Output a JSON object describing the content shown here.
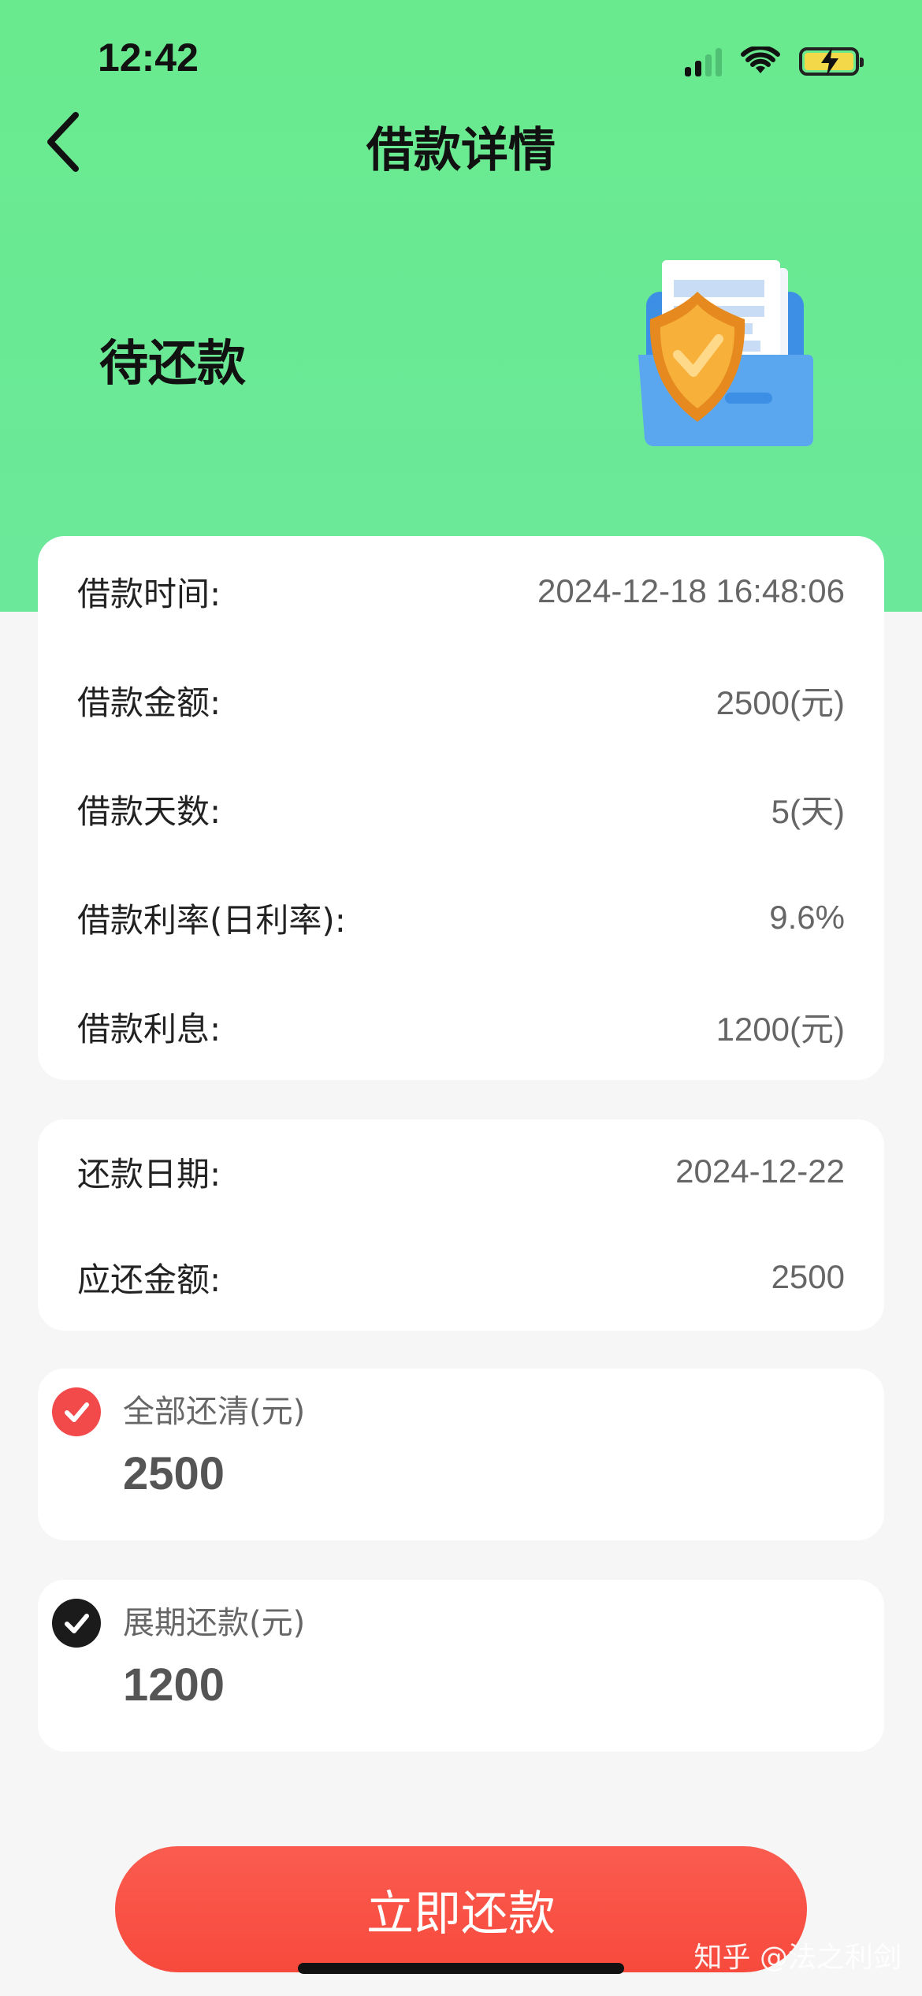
{
  "status_bar": {
    "time": "12:42"
  },
  "nav": {
    "title": "借款详情"
  },
  "loan_status": "待还款",
  "loan_details": [
    {
      "label": "借款时间:",
      "value": "2024-12-18 16:48:06"
    },
    {
      "label": "借款金额:",
      "value": "2500(元)"
    },
    {
      "label": "借款天数:",
      "value": "5(天)"
    },
    {
      "label": "借款利率(日利率):",
      "value": "9.6%"
    },
    {
      "label": "借款利息:",
      "value": "1200(元)"
    }
  ],
  "repayment": [
    {
      "label": "还款日期:",
      "value": "2024-12-22"
    },
    {
      "label": "应还金额:",
      "value": "2500"
    }
  ],
  "options": [
    {
      "label": "全部还清(元)",
      "amount": "2500",
      "checked_color": "#f2494b"
    },
    {
      "label": "展期还款(元)",
      "amount": "1200",
      "checked_color": "#1b1b1b"
    }
  ],
  "pay_button": "立即还款",
  "watermark": "知乎 @法之利剑",
  "colors": {
    "hero": "#6aea8e",
    "button": "#f74a3d"
  },
  "icons": [
    "signal-icon",
    "wifi-icon",
    "battery-icon",
    "back-arrow-icon",
    "document-shield-icon",
    "check-circle-icon"
  ]
}
